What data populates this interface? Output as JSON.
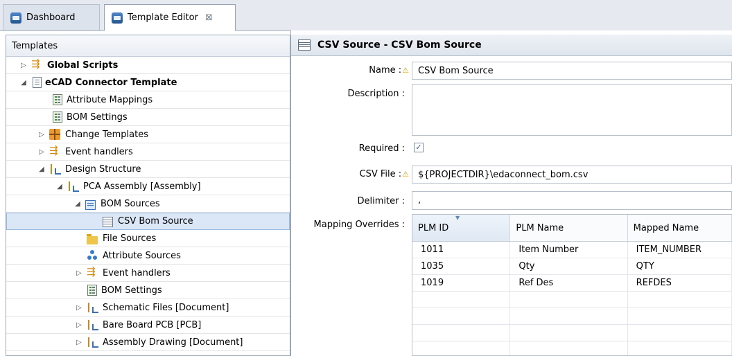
{
  "tabs": [
    {
      "label": "Dashboard"
    },
    {
      "label": "Template Editor",
      "close": "⊠"
    }
  ],
  "tree": {
    "header": "Templates",
    "items": [
      {
        "label": "Global Scripts",
        "toggle": "▷",
        "icon": "script-icon"
      },
      {
        "label": "eCAD Connector Template",
        "toggle": "◢",
        "icon": "document-icon"
      },
      {
        "label": "Attribute Mappings",
        "icon": "list-icon"
      },
      {
        "label": "BOM Settings",
        "icon": "list-icon"
      },
      {
        "label": "Change Templates",
        "toggle": "▷",
        "icon": "grid-icon"
      },
      {
        "label": "Event handlers",
        "toggle": "▷",
        "icon": "script-icon"
      },
      {
        "label": "Design Structure",
        "toggle": "◢",
        "icon": "structure-icon"
      },
      {
        "label": "PCA Assembly [Assembly]",
        "toggle": "◢",
        "icon": "structure-icon"
      },
      {
        "label": "BOM Sources",
        "toggle": "◢",
        "icon": "bom-source-icon"
      },
      {
        "label": "CSV Bom Source",
        "icon": "table-icon",
        "selected": true
      },
      {
        "label": "File Sources",
        "icon": "folder-icon"
      },
      {
        "label": "Attribute Sources",
        "icon": "attribute-icon"
      },
      {
        "label": "Event handlers",
        "toggle": "▷",
        "icon": "script-icon"
      },
      {
        "label": "BOM Settings",
        "icon": "list-icon"
      },
      {
        "label": "Schematic Files [Document]",
        "toggle": "▷",
        "icon": "structure-icon"
      },
      {
        "label": "Bare Board PCB [PCB]",
        "toggle": "▷",
        "icon": "structure-icon"
      },
      {
        "label": "Assembly Drawing [Document]",
        "toggle": "▷",
        "icon": "structure-icon"
      }
    ]
  },
  "editor": {
    "title": "CSV Source - CSV Bom Source",
    "name_label": "Name :",
    "name_value": "CSV Bom Source",
    "description_label": "Description :",
    "description_value": "",
    "required_label": "Required :",
    "required_checked": true,
    "required_mark": "✓",
    "csv_file_label": "CSV File :",
    "csv_file_value": "${PROJECTDIR}\\edaconnect_bom.csv",
    "delimiter_label": "Delimiter :",
    "delimiter_value": ",",
    "mapping_label": "Mapping Overrides :",
    "warning_icon": "⚠"
  },
  "mapping_table": {
    "columns": [
      "PLM ID",
      "PLM Name",
      "Mapped Name"
    ],
    "rows": [
      [
        "1011",
        "Item Number",
        "ITEM_NUMBER"
      ],
      [
        "1035",
        "Qty",
        "QTY"
      ],
      [
        "1019",
        "Ref Des",
        "REFDES"
      ]
    ]
  },
  "colors": {
    "selection": "#dbe7f7",
    "warning": "#d9a000",
    "accent": "#3a6fb5"
  }
}
